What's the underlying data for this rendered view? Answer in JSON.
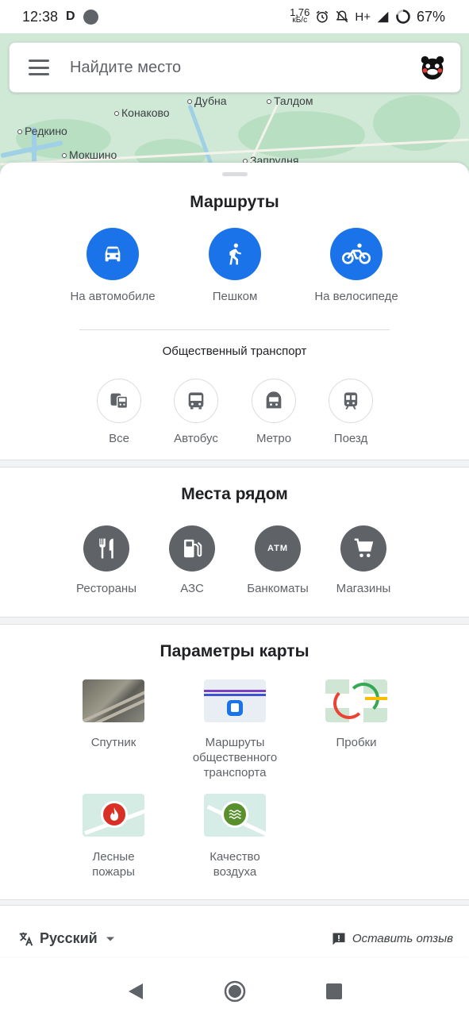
{
  "status_bar": {
    "time": "12:38",
    "net_speed_value": "1,76",
    "net_speed_unit": "кБ/с",
    "network_type": "H+",
    "battery": "67%"
  },
  "map": {
    "places": [
      "Конаково",
      "Дубна",
      "Талдом",
      "Редкино",
      "Мокшино",
      "Запрудня"
    ]
  },
  "search": {
    "placeholder": "Найдите место"
  },
  "routes": {
    "title": "Маршруты",
    "modes": [
      {
        "label": "На автомобиле",
        "icon": "car-icon"
      },
      {
        "label": "Пешком",
        "icon": "walk-icon"
      },
      {
        "label": "На велосипеде",
        "icon": "bike-icon"
      }
    ],
    "transit_title": "Общественный транспорт",
    "transit": [
      {
        "label": "Все",
        "icon": "transit-all-icon"
      },
      {
        "label": "Автобус",
        "icon": "bus-icon"
      },
      {
        "label": "Метро",
        "icon": "subway-icon"
      },
      {
        "label": "Поезд",
        "icon": "train-icon"
      }
    ]
  },
  "nearby": {
    "title": "Места рядом",
    "items": [
      {
        "label": "Рестораны",
        "icon": "restaurant-icon"
      },
      {
        "label": "АЗС",
        "icon": "gas-station-icon"
      },
      {
        "label": "Банкоматы",
        "icon": "atm-icon"
      },
      {
        "label": "Магазины",
        "icon": "shopping-cart-icon"
      }
    ],
    "atm_text": "ATM"
  },
  "map_layers": {
    "title": "Параметры карты",
    "items": [
      {
        "label": "Спутник"
      },
      {
        "label": "Маршруты общественного транспорта"
      },
      {
        "label": "Пробки"
      },
      {
        "label": "Лесные пожары"
      },
      {
        "label": "Качество воздуха"
      }
    ]
  },
  "footer": {
    "language": "Русский",
    "feedback": "Оставить отзыв"
  },
  "colors": {
    "accent": "#1a73e8",
    "icon_grey": "#5f6368"
  }
}
